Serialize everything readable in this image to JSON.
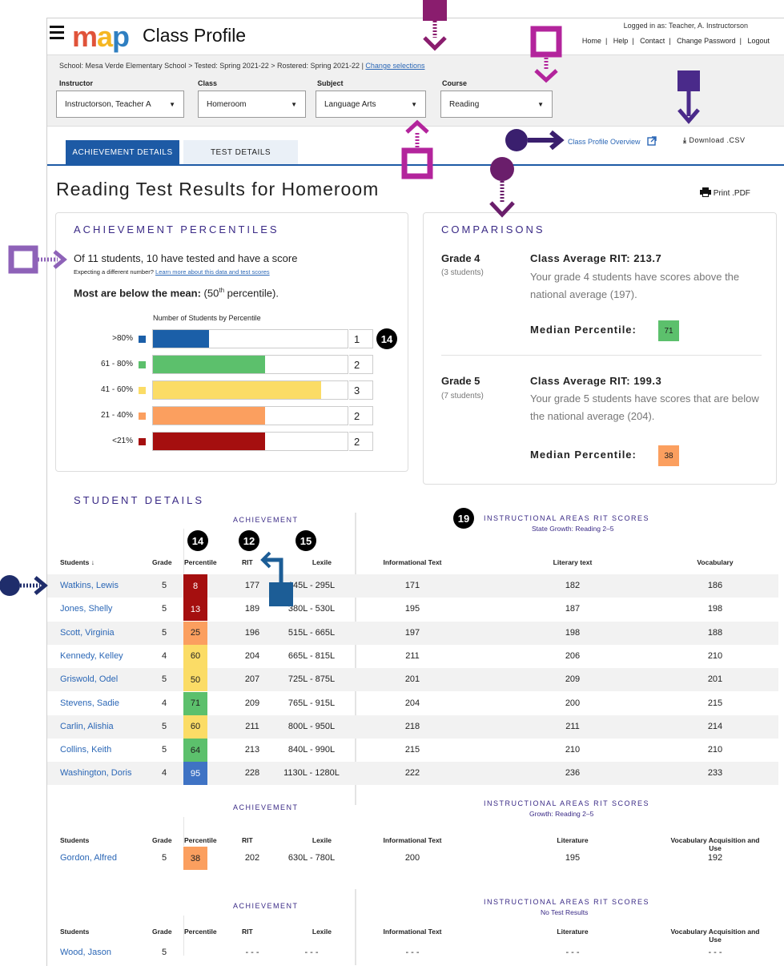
{
  "header": {
    "logo_text": "map",
    "app_title": "Class Profile",
    "logged_in": "Logged in as:  Teacher, A. Instructorson",
    "nav": [
      "Home",
      "Help",
      "Contact",
      "Change Password",
      "Logout"
    ]
  },
  "filters": {
    "breadcrumb": "School: Mesa Verde Elementary School  >  Tested: Spring 2021-22  >  Rostered: Spring 2021-22  |",
    "change_link": "Change selections",
    "fields": [
      {
        "label": "Instructor",
        "value": "Instructorson, Teacher A"
      },
      {
        "label": "Class",
        "value": "Homeroom"
      },
      {
        "label": "Subject",
        "value": "Language Arts"
      },
      {
        "label": "Course",
        "value": "Reading"
      }
    ]
  },
  "tabs": [
    "ACHIEVEMENT DETAILS",
    "TEST DETAILS"
  ],
  "links": {
    "overview": "Class Profile Overview",
    "download": "Download .CSV",
    "print": "Print .PDF"
  },
  "page_title": "Reading Test Results for Homeroom",
  "achievement": {
    "heading": "ACHIEVEMENT PERCENTILES",
    "summary": "Of 11 students, 10 have tested and have a score",
    "expecting": "Expecting a different number?",
    "learn_link": "Learn more about this data and test scores",
    "most_label": "Most are below the mean:",
    "most_value_pre": "(50",
    "most_value_sup": "th",
    "most_value_post": " percentile).",
    "chart_title": "Number of Students by Percentile",
    "colors": {
      "c80": "#1b5fa8",
      "c61": "#5cc06c",
      "c41": "#fbdc66",
      "c21": "#fb9f5f",
      "c0": "#a50f0f"
    }
  },
  "chart_data": {
    "type": "bar",
    "title": "Number of Students by Percentile",
    "categories": [
      ">80%",
      "61 - 80%",
      "41 - 60%",
      "21 - 40%",
      "<21%"
    ],
    "values": [
      1,
      2,
      3,
      2,
      2
    ],
    "xlim": [
      0,
      3.5
    ]
  },
  "comparisons": {
    "heading": "COMPARISONS",
    "grades": [
      {
        "grade": "Grade 4",
        "count": "(3 students)",
        "avg": "Class Average RIT: 213.7",
        "desc": "Your grade 4 students have scores above the national average (197).",
        "median_label": "Median Percentile:",
        "median": "71",
        "color": "#5cc06c"
      },
      {
        "grade": "Grade 5",
        "count": "(7 students)",
        "avg": "Class Average RIT: 199.3",
        "desc": "Your grade 5 students have scores that are below the national average (204).",
        "median_label": "Median Percentile:",
        "median": "38",
        "color": "#fb9f5f"
      }
    ]
  },
  "student_details": {
    "heading": "STUDENT DETAILS",
    "achievement_caption": "ACHIEVEMENT",
    "ia_caption": "INSTRUCTIONAL AREAS RIT SCORES",
    "table1": {
      "sub": "State Growth: Reading 2–5",
      "headers": [
        "Students ↓",
        "Grade",
        "Percentile",
        "RIT",
        "Lexile",
        "Informational Text",
        "Literary text",
        "Vocabulary"
      ],
      "rows": [
        [
          "Watkins, Lewis",
          "5",
          "8",
          "177",
          "145L - 295L",
          "171",
          "182",
          "186"
        ],
        [
          "Jones, Shelly",
          "5",
          "13",
          "189",
          "380L - 530L",
          "195",
          "187",
          "198"
        ],
        [
          "Scott, Virginia",
          "5",
          "25",
          "196",
          "515L - 665L",
          "197",
          "198",
          "188"
        ],
        [
          "Kennedy, Kelley",
          "4",
          "60",
          "204",
          "665L - 815L",
          "211",
          "206",
          "210"
        ],
        [
          "Griswold, Odel",
          "5",
          "50",
          "207",
          "725L - 875L",
          "201",
          "209",
          "201"
        ],
        [
          "Stevens, Sadie",
          "4",
          "71",
          "209",
          "765L - 915L",
          "204",
          "200",
          "215"
        ],
        [
          "Carlin, Alishia",
          "5",
          "60",
          "211",
          "800L - 950L",
          "218",
          "211",
          "214"
        ],
        [
          "Collins, Keith",
          "5",
          "64",
          "213",
          "840L - 990L",
          "215",
          "210",
          "210"
        ],
        [
          "Washington, Doris",
          "4",
          "95",
          "228",
          "1130L - 1280L",
          "222",
          "236",
          "233"
        ]
      ],
      "pct_colors": [
        "#a50f0f",
        "#a50f0f",
        "#fb9f5f",
        "#fbdc66",
        "#fbdc66",
        "#5cc06c",
        "#fbdc66",
        "#5cc06c",
        "#3f73c4"
      ]
    },
    "table2": {
      "sub": "Growth: Reading 2–5",
      "headers": [
        "Students",
        "Grade",
        "Percentile",
        "RIT",
        "Lexile",
        "Informational Text",
        "Literature",
        "Vocabulary Acquisition and Use"
      ],
      "row": [
        "Gordon, Alfred",
        "5",
        "38",
        "202",
        "630L - 780L",
        "200",
        "195",
        "192"
      ],
      "pct_color": "#fb9f5f"
    },
    "table3": {
      "sub": "No Test Results",
      "headers": [
        "Students",
        "Grade",
        "Percentile",
        "RIT",
        "Lexile",
        "Informational Text",
        "Literature",
        "Vocabulary Acquisition and Use"
      ],
      "row": [
        "Wood, Jason",
        "5",
        "",
        "- - -",
        "- - -",
        "- - -",
        "- - -",
        "- - -"
      ]
    }
  },
  "markers": {
    "m14a": "14",
    "m14b": "14",
    "m12": "12",
    "m15": "15",
    "m19": "19"
  }
}
